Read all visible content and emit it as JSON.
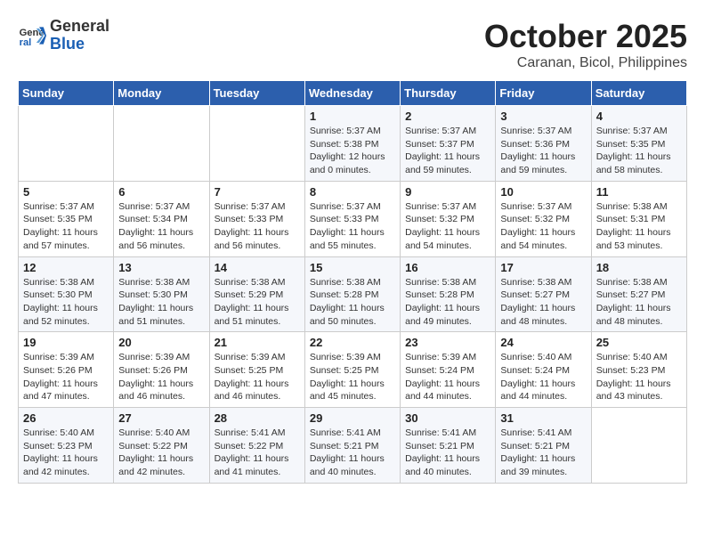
{
  "logo": {
    "line1": "General",
    "line2": "Blue"
  },
  "title": "October 2025",
  "location": "Caranan, Bicol, Philippines",
  "weekdays": [
    "Sunday",
    "Monday",
    "Tuesday",
    "Wednesday",
    "Thursday",
    "Friday",
    "Saturday"
  ],
  "weeks": [
    [
      {
        "day": "",
        "info": ""
      },
      {
        "day": "",
        "info": ""
      },
      {
        "day": "",
        "info": ""
      },
      {
        "day": "1",
        "info": "Sunrise: 5:37 AM\nSunset: 5:38 PM\nDaylight: 12 hours\nand 0 minutes."
      },
      {
        "day": "2",
        "info": "Sunrise: 5:37 AM\nSunset: 5:37 PM\nDaylight: 11 hours\nand 59 minutes."
      },
      {
        "day": "3",
        "info": "Sunrise: 5:37 AM\nSunset: 5:36 PM\nDaylight: 11 hours\nand 59 minutes."
      },
      {
        "day": "4",
        "info": "Sunrise: 5:37 AM\nSunset: 5:35 PM\nDaylight: 11 hours\nand 58 minutes."
      }
    ],
    [
      {
        "day": "5",
        "info": "Sunrise: 5:37 AM\nSunset: 5:35 PM\nDaylight: 11 hours\nand 57 minutes."
      },
      {
        "day": "6",
        "info": "Sunrise: 5:37 AM\nSunset: 5:34 PM\nDaylight: 11 hours\nand 56 minutes."
      },
      {
        "day": "7",
        "info": "Sunrise: 5:37 AM\nSunset: 5:33 PM\nDaylight: 11 hours\nand 56 minutes."
      },
      {
        "day": "8",
        "info": "Sunrise: 5:37 AM\nSunset: 5:33 PM\nDaylight: 11 hours\nand 55 minutes."
      },
      {
        "day": "9",
        "info": "Sunrise: 5:37 AM\nSunset: 5:32 PM\nDaylight: 11 hours\nand 54 minutes."
      },
      {
        "day": "10",
        "info": "Sunrise: 5:37 AM\nSunset: 5:32 PM\nDaylight: 11 hours\nand 54 minutes."
      },
      {
        "day": "11",
        "info": "Sunrise: 5:38 AM\nSunset: 5:31 PM\nDaylight: 11 hours\nand 53 minutes."
      }
    ],
    [
      {
        "day": "12",
        "info": "Sunrise: 5:38 AM\nSunset: 5:30 PM\nDaylight: 11 hours\nand 52 minutes."
      },
      {
        "day": "13",
        "info": "Sunrise: 5:38 AM\nSunset: 5:30 PM\nDaylight: 11 hours\nand 51 minutes."
      },
      {
        "day": "14",
        "info": "Sunrise: 5:38 AM\nSunset: 5:29 PM\nDaylight: 11 hours\nand 51 minutes."
      },
      {
        "day": "15",
        "info": "Sunrise: 5:38 AM\nSunset: 5:28 PM\nDaylight: 11 hours\nand 50 minutes."
      },
      {
        "day": "16",
        "info": "Sunrise: 5:38 AM\nSunset: 5:28 PM\nDaylight: 11 hours\nand 49 minutes."
      },
      {
        "day": "17",
        "info": "Sunrise: 5:38 AM\nSunset: 5:27 PM\nDaylight: 11 hours\nand 48 minutes."
      },
      {
        "day": "18",
        "info": "Sunrise: 5:38 AM\nSunset: 5:27 PM\nDaylight: 11 hours\nand 48 minutes."
      }
    ],
    [
      {
        "day": "19",
        "info": "Sunrise: 5:39 AM\nSunset: 5:26 PM\nDaylight: 11 hours\nand 47 minutes."
      },
      {
        "day": "20",
        "info": "Sunrise: 5:39 AM\nSunset: 5:26 PM\nDaylight: 11 hours\nand 46 minutes."
      },
      {
        "day": "21",
        "info": "Sunrise: 5:39 AM\nSunset: 5:25 PM\nDaylight: 11 hours\nand 46 minutes."
      },
      {
        "day": "22",
        "info": "Sunrise: 5:39 AM\nSunset: 5:25 PM\nDaylight: 11 hours\nand 45 minutes."
      },
      {
        "day": "23",
        "info": "Sunrise: 5:39 AM\nSunset: 5:24 PM\nDaylight: 11 hours\nand 44 minutes."
      },
      {
        "day": "24",
        "info": "Sunrise: 5:40 AM\nSunset: 5:24 PM\nDaylight: 11 hours\nand 44 minutes."
      },
      {
        "day": "25",
        "info": "Sunrise: 5:40 AM\nSunset: 5:23 PM\nDaylight: 11 hours\nand 43 minutes."
      }
    ],
    [
      {
        "day": "26",
        "info": "Sunrise: 5:40 AM\nSunset: 5:23 PM\nDaylight: 11 hours\nand 42 minutes."
      },
      {
        "day": "27",
        "info": "Sunrise: 5:40 AM\nSunset: 5:22 PM\nDaylight: 11 hours\nand 42 minutes."
      },
      {
        "day": "28",
        "info": "Sunrise: 5:41 AM\nSunset: 5:22 PM\nDaylight: 11 hours\nand 41 minutes."
      },
      {
        "day": "29",
        "info": "Sunrise: 5:41 AM\nSunset: 5:21 PM\nDaylight: 11 hours\nand 40 minutes."
      },
      {
        "day": "30",
        "info": "Sunrise: 5:41 AM\nSunset: 5:21 PM\nDaylight: 11 hours\nand 40 minutes."
      },
      {
        "day": "31",
        "info": "Sunrise: 5:41 AM\nSunset: 5:21 PM\nDaylight: 11 hours\nand 39 minutes."
      },
      {
        "day": "",
        "info": ""
      }
    ]
  ]
}
